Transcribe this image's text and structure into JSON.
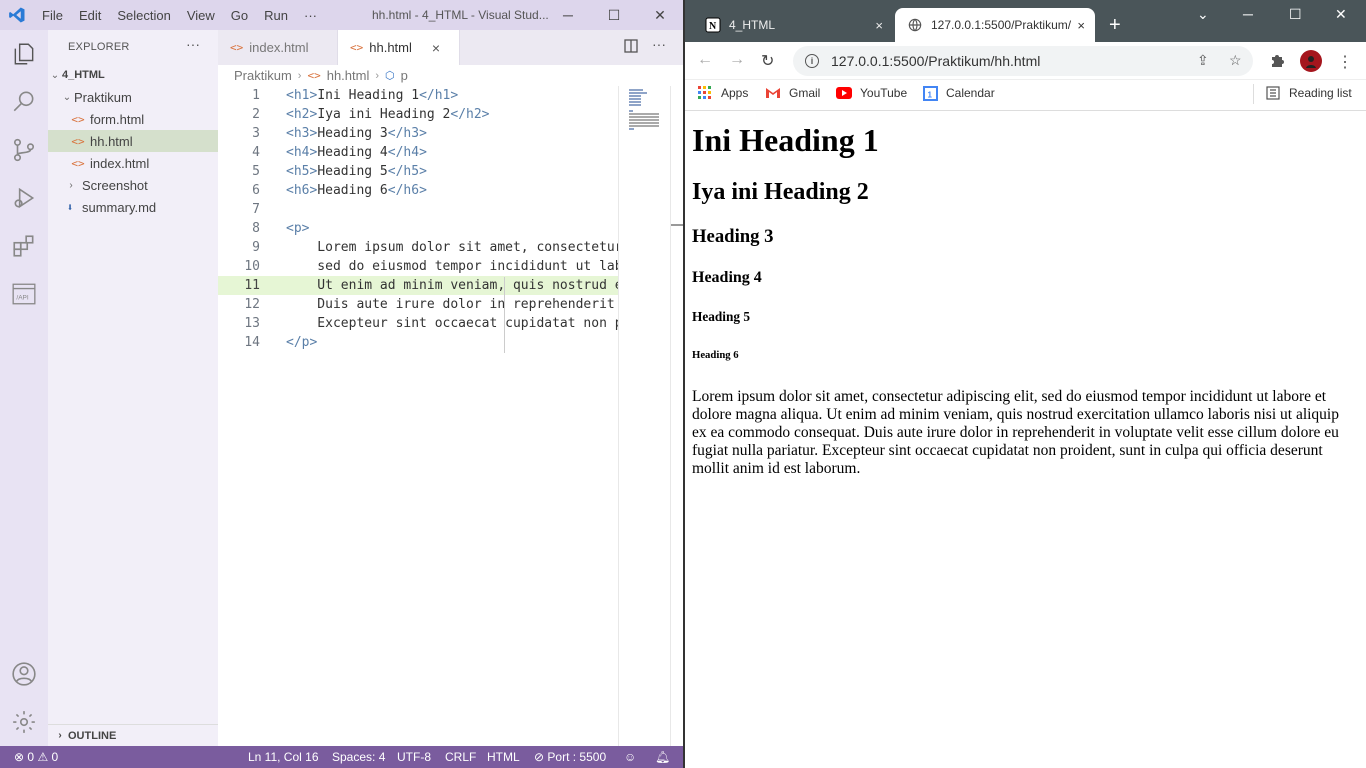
{
  "vscode": {
    "menu": [
      "File",
      "Edit",
      "Selection",
      "View",
      "Go",
      "Run",
      "···"
    ],
    "window_title": "hh.html - 4_HTML - Visual Stud...",
    "explorer": {
      "header": "EXPLORER",
      "more": "···",
      "root": "4_HTML",
      "items": [
        {
          "label": "Praktikum",
          "kind": "folder-open",
          "depth": 1
        },
        {
          "label": "form.html",
          "kind": "html",
          "depth": 2
        },
        {
          "label": "hh.html",
          "kind": "html",
          "depth": 2,
          "selected": true
        },
        {
          "label": "index.html",
          "kind": "html",
          "depth": 2
        },
        {
          "label": "Screenshot",
          "kind": "folder",
          "depth": 1
        },
        {
          "label": "summary.md",
          "kind": "md",
          "depth": 1
        }
      ],
      "outline": "OUTLINE"
    },
    "tabs": [
      {
        "label": "index.html",
        "icon": "<>",
        "active": false
      },
      {
        "label": "hh.html",
        "icon": "<>",
        "active": true,
        "close": "×"
      }
    ],
    "breadcrumb": [
      "Praktikum",
      "hh.html",
      "p"
    ],
    "code_lines": [
      {
        "n": "1",
        "parts": [
          [
            "t",
            "<h1>"
          ],
          [
            "x",
            "Ini Heading 1"
          ],
          [
            "t",
            "</h1>"
          ]
        ]
      },
      {
        "n": "2",
        "parts": [
          [
            "t",
            "<h2>"
          ],
          [
            "x",
            "Iya ini Heading 2"
          ],
          [
            "t",
            "</h2>"
          ]
        ]
      },
      {
        "n": "3",
        "parts": [
          [
            "t",
            "<h3>"
          ],
          [
            "x",
            "Heading 3"
          ],
          [
            "t",
            "</h3>"
          ]
        ]
      },
      {
        "n": "4",
        "parts": [
          [
            "t",
            "<h4>"
          ],
          [
            "x",
            "Heading 4"
          ],
          [
            "t",
            "</h4>"
          ]
        ]
      },
      {
        "n": "5",
        "parts": [
          [
            "t",
            "<h5>"
          ],
          [
            "x",
            "Heading 5"
          ],
          [
            "t",
            "</h5>"
          ]
        ]
      },
      {
        "n": "6",
        "parts": [
          [
            "t",
            "<h6>"
          ],
          [
            "x",
            "Heading 6"
          ],
          [
            "t",
            "</h6>"
          ]
        ]
      },
      {
        "n": "7",
        "parts": []
      },
      {
        "n": "8",
        "parts": [
          [
            "t",
            "<p>"
          ]
        ]
      },
      {
        "n": "9",
        "parts": [
          [
            "x",
            "    Lorem ipsum dolor sit amet, consectetur"
          ]
        ]
      },
      {
        "n": "10",
        "parts": [
          [
            "x",
            "    sed do eiusmod tempor incididunt ut labo"
          ]
        ]
      },
      {
        "n": "11",
        "parts": [
          [
            "x",
            "    Ut enim ad minim veniam, quis nostrud e"
          ]
        ],
        "highlight": true
      },
      {
        "n": "12",
        "parts": [
          [
            "x",
            "    Duis aute irure dolor in reprehenderit"
          ]
        ]
      },
      {
        "n": "13",
        "parts": [
          [
            "x",
            "    Excepteur sint occaecat cupidatat non p"
          ]
        ]
      },
      {
        "n": "14",
        "parts": [
          [
            "t",
            "</p>"
          ]
        ]
      }
    ],
    "status": {
      "errors": "0",
      "warnings": "0",
      "position": "Ln 11, Col 16",
      "spaces": "Spaces: 4",
      "encoding": "UTF-8",
      "eol": "CRLF",
      "language": "HTML",
      "port": "Port : 5500"
    }
  },
  "chrome": {
    "tabs": [
      {
        "label": "4_HTML",
        "active": false,
        "close": "×"
      },
      {
        "label": "127.0.0.1:5500/Praktikum/",
        "active": true,
        "close": "×"
      }
    ],
    "new_tab": "+",
    "url": "127.0.0.1:5500/Praktikum/hh.html",
    "bookmarks": [
      "Apps",
      "Gmail",
      "YouTube",
      "Calendar"
    ],
    "reading_list": "Reading list",
    "page": {
      "h1": "Ini Heading 1",
      "h2": "Iya ini Heading 2",
      "h3": "Heading 3",
      "h4": "Heading 4",
      "h5": "Heading 5",
      "h6": "Heading 6",
      "p": "Lorem ipsum dolor sit amet, consectetur adipiscing elit, sed do eiusmod tempor incididunt ut labore et dolore magna aliqua. Ut enim ad minim veniam, quis nostrud exercitation ullamco laboris nisi ut aliquip ex ea commodo consequat. Duis aute irure dolor in reprehenderit in voluptate velit esse cillum dolore eu fugiat nulla pariatur. Excepteur sint occaecat cupidatat non proident, sunt in culpa qui officia deserunt mollit anim id est laborum."
    }
  },
  "colors": {
    "vscode_statusbar": "#7a5c9e",
    "vscode_titlebar": "#ddd6ec",
    "chrome_tabstrip": "#4a5559"
  }
}
